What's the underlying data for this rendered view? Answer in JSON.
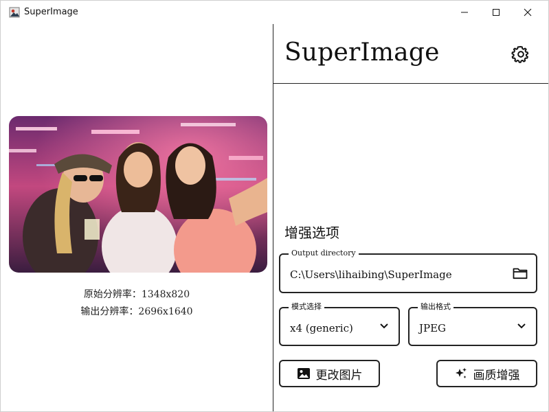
{
  "window": {
    "title": "SuperImage"
  },
  "left": {
    "original_resolution": "原始分辨率：1348x820",
    "output_resolution": "输出分辨率：2696x1640"
  },
  "right": {
    "brand": "SuperImage",
    "section_title": "增强选项",
    "output_directory": {
      "label": "Output directory",
      "value": "C:\\Users\\lihaibing\\SuperImage"
    },
    "mode": {
      "label": "模式选择",
      "value": "x4 (generic)"
    },
    "format": {
      "label": "输出格式",
      "value": "JPEG"
    },
    "change_button": "更改图片",
    "enhance_button": "画质增强"
  },
  "icons": {
    "settings": "gear-icon",
    "folder": "folder-icon",
    "image": "image-icon",
    "sparkle": "sparkle-icon",
    "chevron": "chevron-down-icon"
  }
}
